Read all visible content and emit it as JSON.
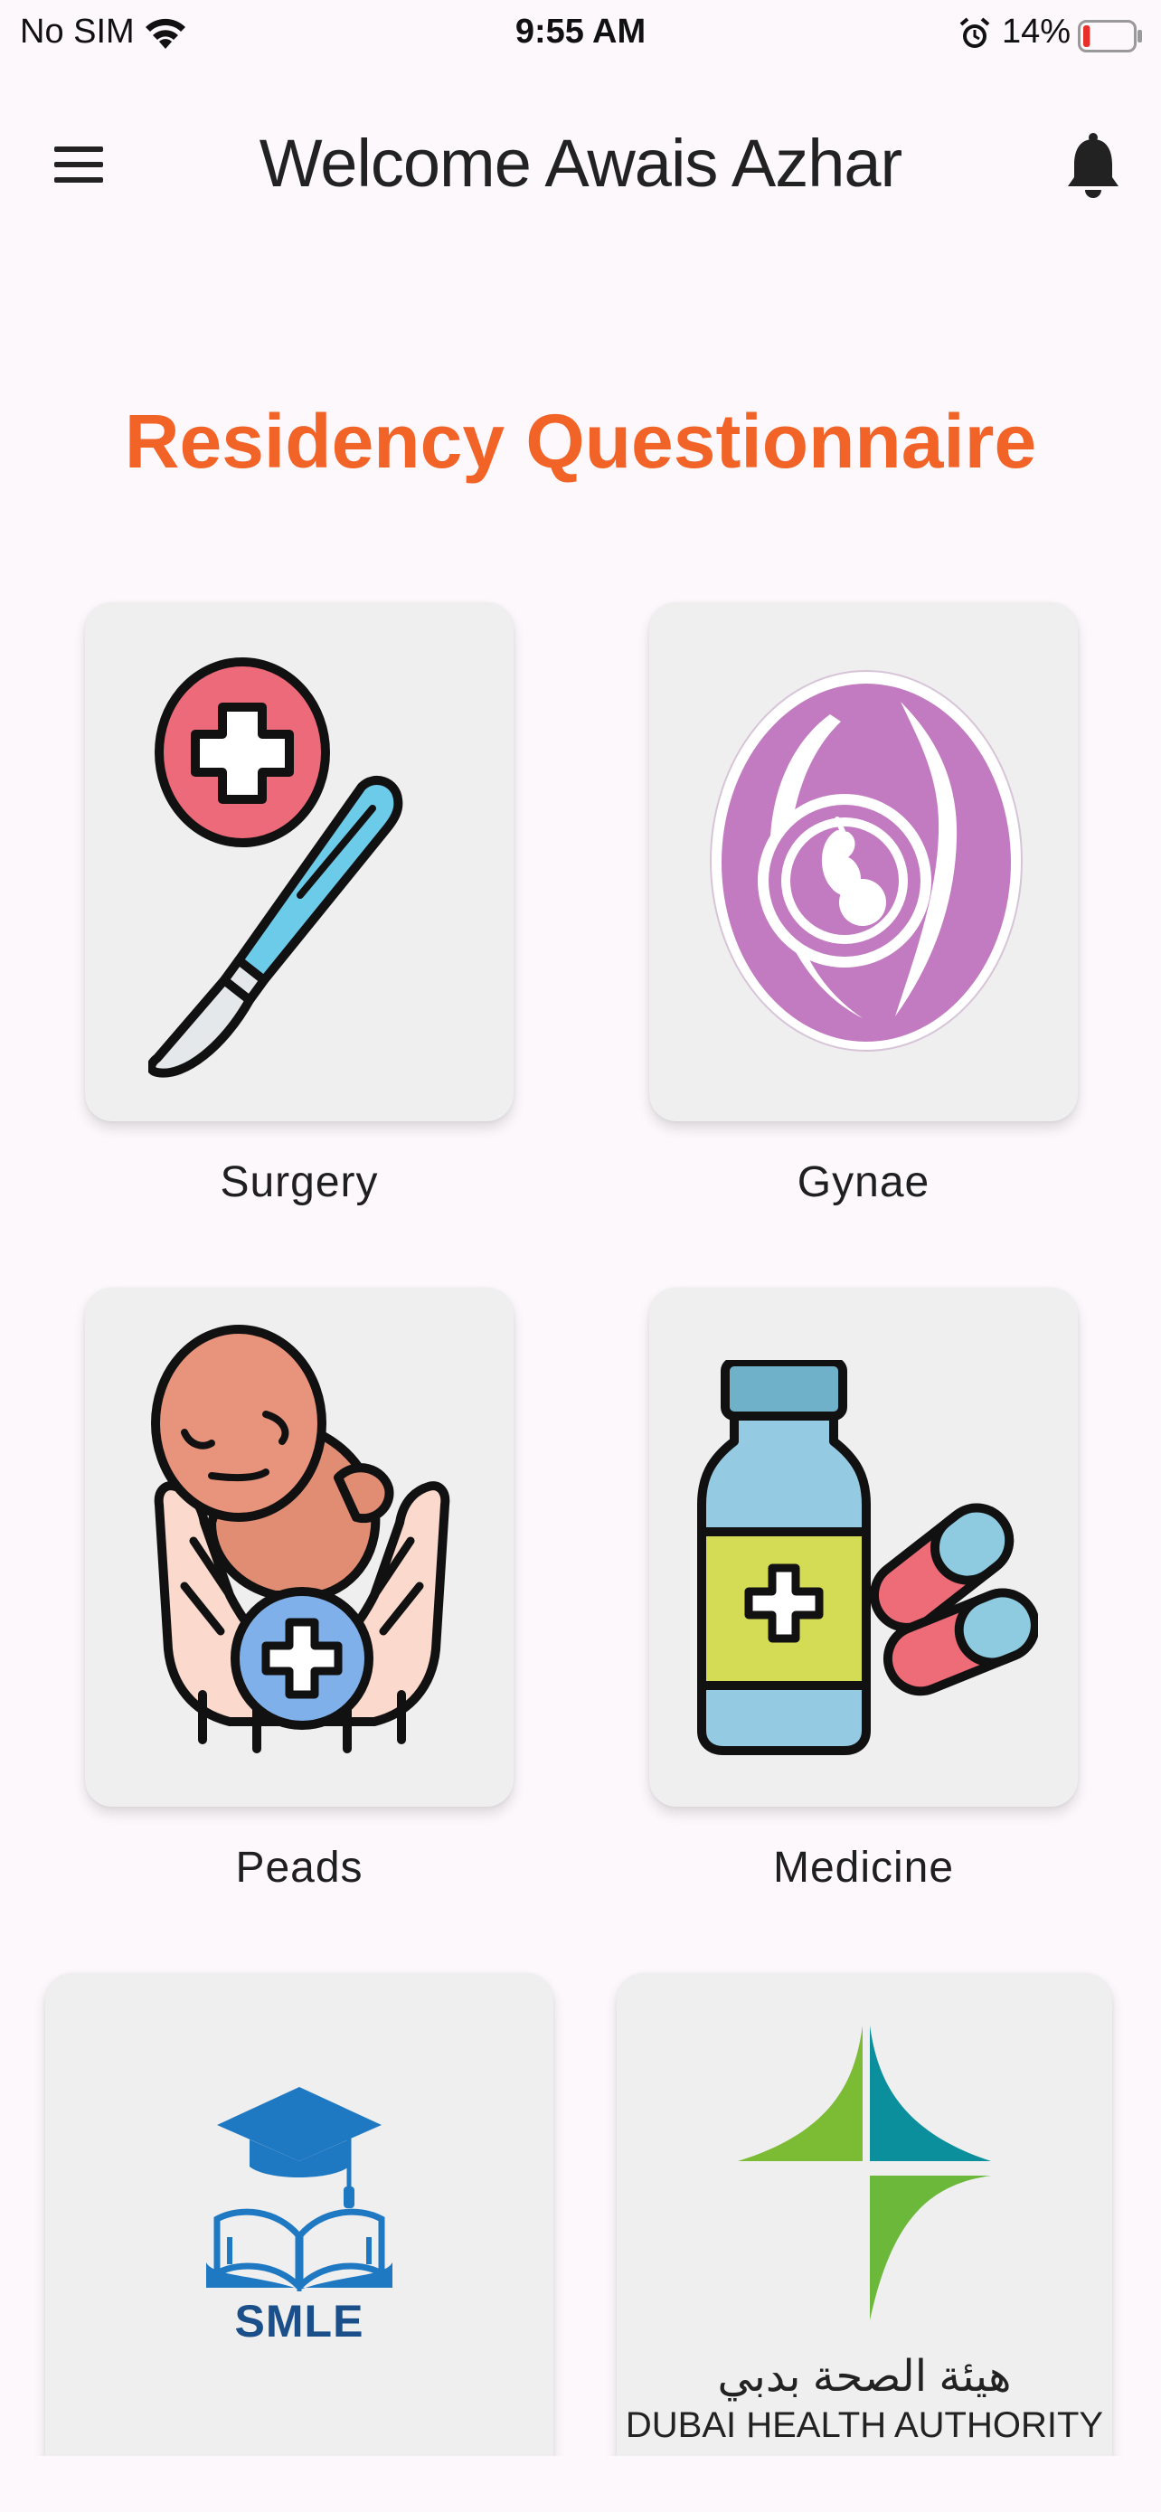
{
  "status_bar": {
    "carrier": "No SIM",
    "time": "9:55 AM",
    "battery": "14%",
    "battery_level": 0.14,
    "icons": [
      "wifi-icon",
      "alarm-icon",
      "battery-icon"
    ]
  },
  "header": {
    "welcome": "Welcome Awais Azhar",
    "icons": [
      "menu-icon",
      "bell-icon"
    ]
  },
  "main": {
    "title": "Residency Questionnaire",
    "cards": [
      {
        "label": "Surgery",
        "icon": "scalpel-icon"
      },
      {
        "label": "Gynae",
        "icon": "pregnancy-icon"
      },
      {
        "label": "Peads",
        "icon": "baby-in-hands-icon"
      },
      {
        "label": "Medicine",
        "icon": "medicine-bottle-icon"
      },
      {
        "label": "",
        "icon": "smle-logo",
        "logo_text": "SMLE"
      },
      {
        "label": "",
        "icon": "dubai-health-authority-logo",
        "logo_arabic": "هيئة الصحة بدبي",
        "logo_english": "DUBAI HEALTH AUTHORITY"
      }
    ]
  },
  "colors": {
    "title": "#f26328",
    "background": "#fcf8fc",
    "card": "#efefef"
  }
}
